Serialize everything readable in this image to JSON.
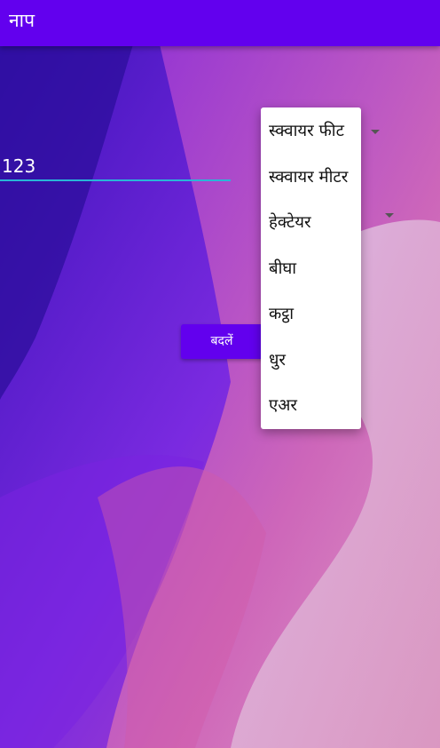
{
  "app": {
    "title": "नाप"
  },
  "input": {
    "value": "123"
  },
  "convert_button": {
    "label": "बदलें"
  },
  "unit_menu": {
    "options": [
      "स्क्वायर फीट",
      "स्क्वायर मीटर",
      "हेक्टेयर",
      "बीघा",
      "कट्ठा",
      "धुर",
      "एअर"
    ]
  },
  "colors": {
    "app_bar": "#6200ee",
    "button": "#6200ee",
    "underline": "#29b6d8"
  }
}
